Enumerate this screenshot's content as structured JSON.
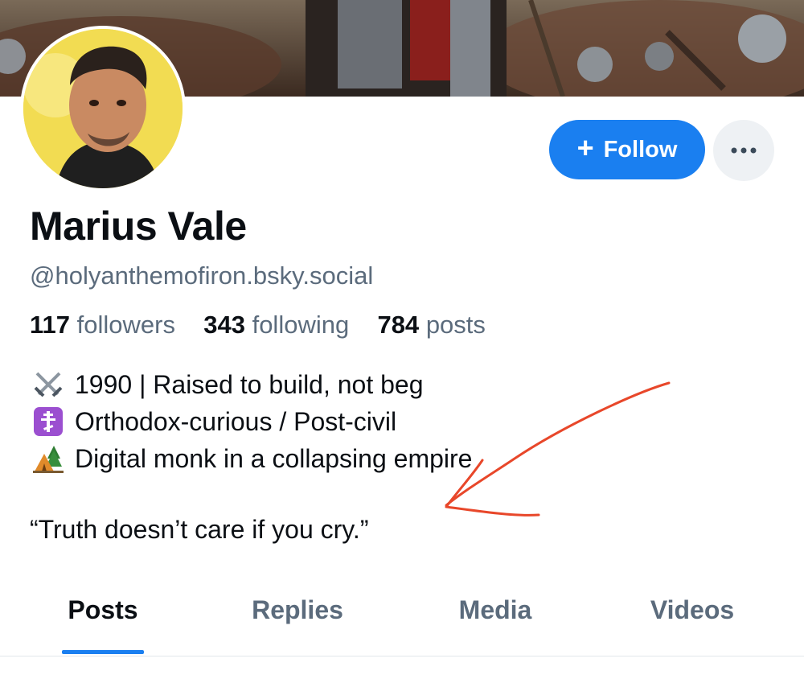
{
  "profile": {
    "name": "Marius Vale",
    "handle": "@holyanthemofiron.bsky.social",
    "stats": {
      "followers_count": "117",
      "followers_label": "followers",
      "following_count": "343",
      "following_label": "following",
      "posts_count": "784",
      "posts_label": "posts"
    },
    "bio": [
      {
        "icon": "crossed-swords-icon",
        "text": "1990 | Raised to build, not beg"
      },
      {
        "icon": "orthodox-cross-icon",
        "text": "Orthodox-curious / Post-civil"
      },
      {
        "icon": "camping-tent-icon",
        "text": "Digital monk in a collapsing empire"
      }
    ],
    "quote": "“Truth doesn’t care if you cry.”"
  },
  "actions": {
    "follow_plus": "+",
    "follow_label": "Follow",
    "more_icon": "ellipsis-icon"
  },
  "tabs": [
    {
      "label": "Posts",
      "active": true
    },
    {
      "label": "Replies",
      "active": false
    },
    {
      "label": "Media",
      "active": false
    },
    {
      "label": "Videos",
      "active": false
    }
  ],
  "colors": {
    "accent": "#1a7ff0",
    "annotation_arrow": "#e8472a",
    "muted_text": "#5b6b7c"
  }
}
